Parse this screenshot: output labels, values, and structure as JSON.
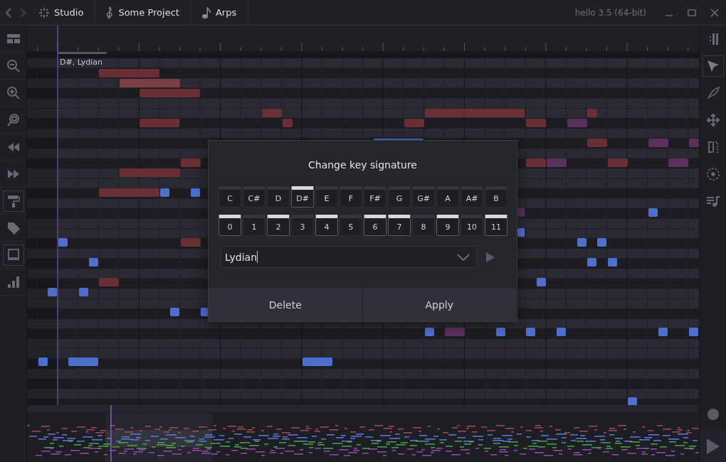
{
  "window": {
    "title": "hello 3.5 (64-bit)"
  },
  "breadcrumbs": [
    {
      "label": "Studio",
      "kind": "studio"
    },
    {
      "label": "Some Project",
      "kind": "project"
    },
    {
      "label": "Arps",
      "kind": "track"
    }
  ],
  "left_toolbar": [
    {
      "kind": "layout",
      "active": false
    },
    {
      "kind": "zoom-out",
      "active": false
    },
    {
      "kind": "zoom-in",
      "active": false
    },
    {
      "kind": "zoom-fit",
      "active": false
    },
    {
      "kind": "rewind",
      "active": false
    },
    {
      "kind": "forward",
      "active": false
    },
    {
      "kind": "roller",
      "active": true
    },
    {
      "kind": "tag",
      "active": false
    },
    {
      "kind": "monitor",
      "active": true
    },
    {
      "kind": "bars",
      "active": false
    }
  ],
  "right_toolbar": [
    {
      "kind": "split",
      "selected": false
    },
    {
      "kind": "pointer",
      "selected": true
    },
    {
      "kind": "pen",
      "selected": false
    },
    {
      "kind": "move",
      "selected": false
    },
    {
      "kind": "mirror",
      "selected": false
    },
    {
      "kind": "circle",
      "selected": false
    },
    {
      "kind": "playlist",
      "selected": false
    }
  ],
  "roll": {
    "key_signature_label": "D#, Lydian"
  },
  "dialog": {
    "title": "Change key signature",
    "keys": [
      {
        "label": "C",
        "selected": false
      },
      {
        "label": "C#",
        "selected": false
      },
      {
        "label": "D",
        "selected": false
      },
      {
        "label": "D#",
        "selected": true
      },
      {
        "label": "E",
        "selected": false
      },
      {
        "label": "F",
        "selected": false
      },
      {
        "label": "F#",
        "selected": false
      },
      {
        "label": "G",
        "selected": false
      },
      {
        "label": "G#",
        "selected": false
      },
      {
        "label": "A",
        "selected": false
      },
      {
        "label": "A#",
        "selected": false
      },
      {
        "label": "B",
        "selected": false
      }
    ],
    "intervals": [
      {
        "label": "0",
        "on": true
      },
      {
        "label": "1",
        "on": false
      },
      {
        "label": "2",
        "on": true
      },
      {
        "label": "3",
        "on": false
      },
      {
        "label": "4",
        "on": true
      },
      {
        "label": "5",
        "on": false
      },
      {
        "label": "6",
        "on": true
      },
      {
        "label": "7",
        "on": true
      },
      {
        "label": "8",
        "on": false
      },
      {
        "label": "9",
        "on": true
      },
      {
        "label": "10",
        "on": false
      },
      {
        "label": "11",
        "on": true
      }
    ],
    "scale": {
      "value": "Lydian"
    },
    "buttons": [
      {
        "label": "Delete"
      },
      {
        "label": "Apply"
      }
    ]
  }
}
